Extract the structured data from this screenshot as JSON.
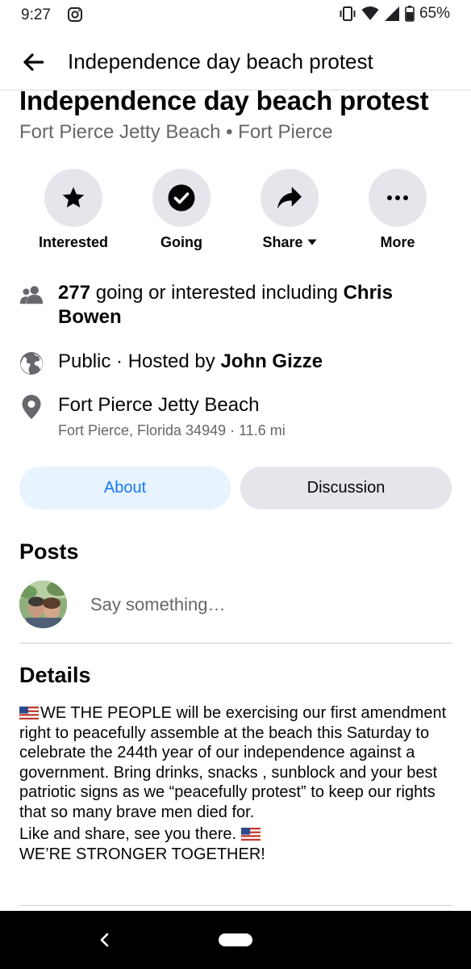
{
  "status_bar": {
    "time": "9:27",
    "battery": "65%"
  },
  "header": {
    "title": "Independence day beach protest"
  },
  "event": {
    "title": "Independence day beach protest",
    "location": "Fort Pierce Jetty Beach • Fort Pierce"
  },
  "actions": {
    "interested": "Interested",
    "going": "Going",
    "share": "Share",
    "more": "More"
  },
  "info": {
    "going_count": "277",
    "going_text": "going or interested including",
    "going_friend": "Chris Bowen",
    "privacy": "Public · Hosted by",
    "host": "John Gizze",
    "place_name": "Fort Pierce Jetty Beach",
    "place_address": "Fort Pierce, Florida 34949 · 11.6 mi"
  },
  "tabs": {
    "about": "About",
    "discussion": "Discussion"
  },
  "posts": {
    "title": "Posts",
    "placeholder": "Say something…"
  },
  "details": {
    "title": "Details",
    "paragraph1": "WE THE PEOPLE will be exercising our first amendment right to peacefully assemble at the beach this Saturday to celebrate the 244th year of our independence against a government. Bring drinks, snacks , sunblock and your best patriotic signs as we “peacefully protest” to keep our rights that so many brave men died for.",
    "paragraph2_line1": "Like and share, see you there.",
    "paragraph2_line2": "WE’RE STRONGER TOGETHER!"
  },
  "colors": {
    "accent": "#1877f2",
    "secondary_text": "#65676b",
    "button_bg": "#e4e6eb"
  }
}
